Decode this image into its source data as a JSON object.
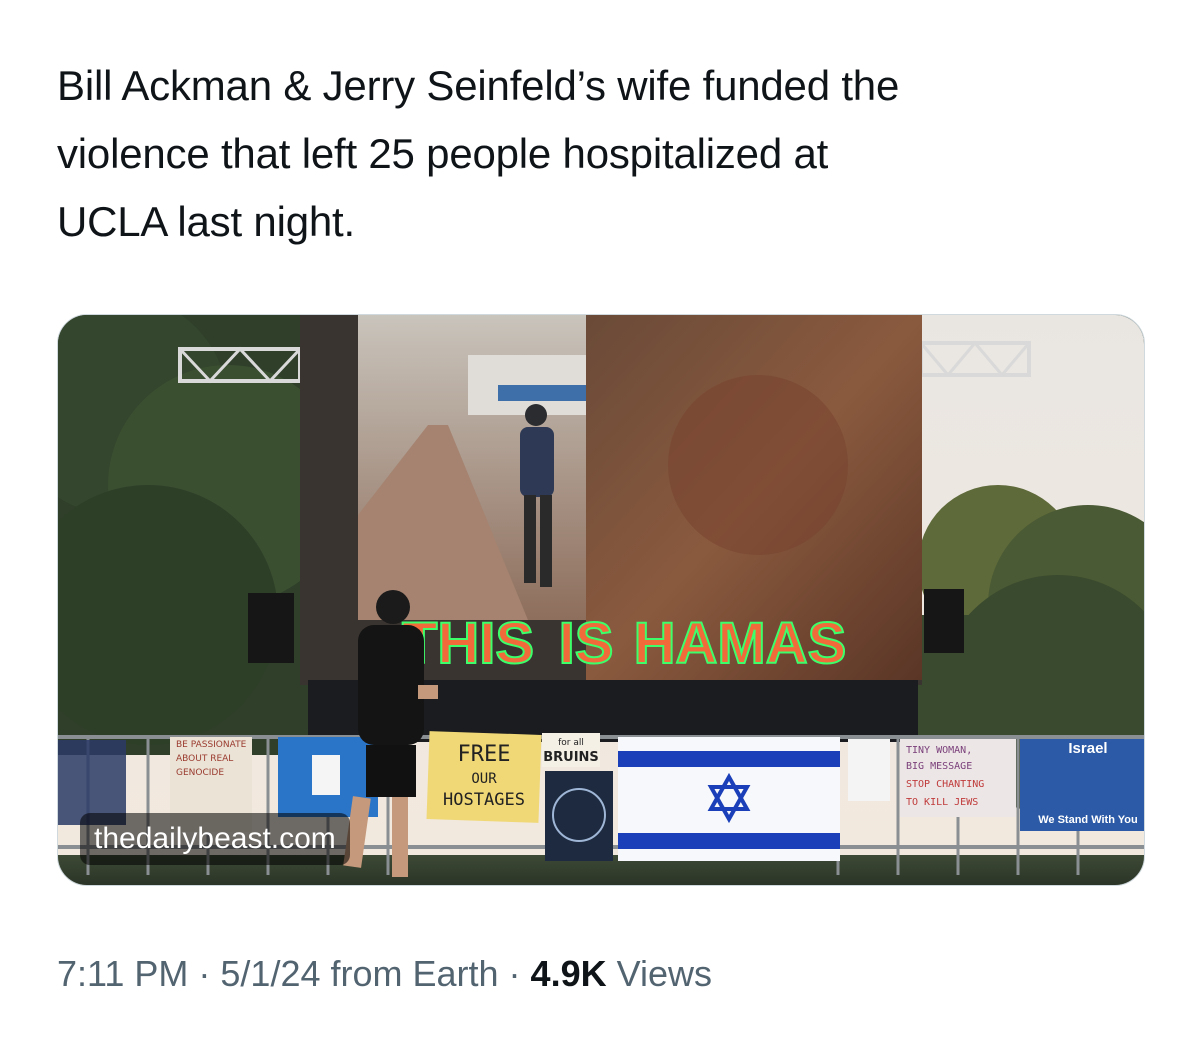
{
  "tweet": {
    "text_lines": [
      "Bill Ackman & Jerry Seinfeld’s wife funded the",
      "violence that left 25 people hospitalized at",
      "UCLA last night."
    ]
  },
  "media": {
    "screen_caption": {
      "word1": "THIS",
      "word2": "IS",
      "word3": "HAMAS"
    },
    "signs": {
      "free_hostages": [
        "FREE",
        "OUR",
        "HOSTAGES"
      ],
      "bruins": [
        "for all",
        "BRUINS"
      ],
      "tiny_woman": [
        "TINY WOMAN,",
        "BIG MESSAGE",
        "STOP CHANTING",
        "TO KILL JEWS"
      ],
      "israel_banner_top": "Israel",
      "israel_banner_bottom": "We Stand With You",
      "left_sign": [
        "BE PASSIONATE",
        "ABOUT REAL",
        "GENOCIDE"
      ]
    },
    "domain_label": "thedailybeast.com"
  },
  "meta": {
    "time": "7:11 PM",
    "sep1": " · ",
    "date_source": "5/1/24 from Earth",
    "sep2": " · ",
    "views_count": "4.9K",
    "views_label": " Views"
  },
  "colors": {
    "text_primary": "#0f1419",
    "text_secondary": "#536471",
    "caption_fill": "#f06a3a",
    "caption_glow": "#3cff6a",
    "israel_blue": "#1b3fb8"
  }
}
